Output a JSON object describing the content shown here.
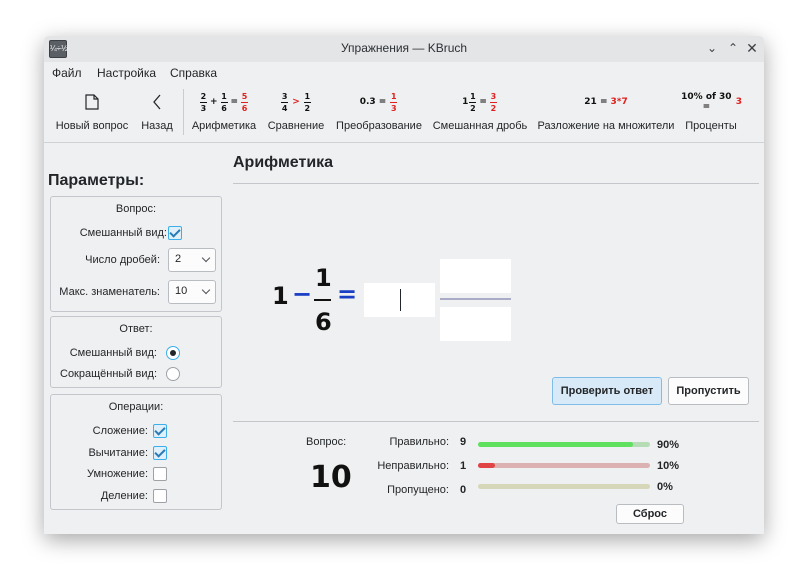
{
  "window": {
    "title": "Упражнения — KBruch",
    "app_icon_text": "¼÷½"
  },
  "menu": {
    "items": [
      "Файл",
      "Настройка",
      "Справка"
    ]
  },
  "toolbar": {
    "new_question": "Новый вопрос",
    "back": "Назад",
    "arithmetic": "Арифметика",
    "comparison": "Сравнение",
    "conversion": "Преобразование",
    "mixed_fraction": "Смешанная дробь",
    "factorization": "Разложение на множители",
    "percentage": "Проценты",
    "icons": {
      "arith": {
        "a_num": "2",
        "a_den": "3",
        "op": "+",
        "b_num": "1",
        "b_den": "6",
        "eq": "=",
        "r_num": "5",
        "r_den": "6"
      },
      "compare": {
        "a_num": "3",
        "a_den": "4",
        "op": ">",
        "b_num": "1",
        "b_den": "2"
      },
      "convert": {
        "lhs": "0.3 =",
        "r_num": "1",
        "r_den": "3"
      },
      "mixed": {
        "whole": "1",
        "a_num": "1",
        "a_den": "2",
        "eq": "=",
        "r_num": "3",
        "r_den": "2"
      },
      "factor": {
        "lhs": "21 =",
        "rhs": "3*7"
      },
      "percent": {
        "lhs": "10% of 30 =",
        "rhs": "3"
      }
    }
  },
  "params": {
    "title": "Параметры:",
    "question_group": {
      "title": "Вопрос:",
      "mixed_label": "Смешанный вид:",
      "mixed_checked": true,
      "fractions_label": "Число дробей:",
      "fractions_value": "2",
      "max_den_label": "Макс. знаменатель:",
      "max_den_value": "10"
    },
    "answer_group": {
      "title": "Ответ:",
      "mixed_label": "Смешанный вид:",
      "reduced_label": "Сокращённый вид:",
      "selected": "mixed"
    },
    "ops_group": {
      "title": "Операции:",
      "add_label": "Сложение:",
      "add_checked": true,
      "sub_label": "Вычитание:",
      "sub_checked": true,
      "mul_label": "Умножение:",
      "mul_checked": false,
      "div_label": "Деление:",
      "div_checked": false
    }
  },
  "task": {
    "title": "Арифметика",
    "whole": "1",
    "op": "−",
    "num": "1",
    "den": "6",
    "eq": "=",
    "answer_whole": "",
    "answer_num": "",
    "answer_den": ""
  },
  "buttons": {
    "check": "Проверить ответ",
    "skip": "Пропустить",
    "reset": "Сброс"
  },
  "stats": {
    "question_label": "Вопрос:",
    "question_number": "10",
    "correct_label": "Правильно:",
    "correct_count": "9",
    "correct_pct": "90%",
    "correct_fraction": 0.9,
    "wrong_label": "Неправильно:",
    "wrong_count": "1",
    "wrong_pct": "10%",
    "wrong_fraction": 0.1,
    "skipped_label": "Пропущено:",
    "skipped_count": "0",
    "skipped_pct": "0%",
    "skipped_fraction": 0.0
  },
  "colors": {
    "accent": "#3daee9",
    "operator_blue": "#1b3fc4",
    "correct_green": "#5fe05f",
    "wrong_red": "#e04444",
    "highlight_red": "#e0201f"
  }
}
